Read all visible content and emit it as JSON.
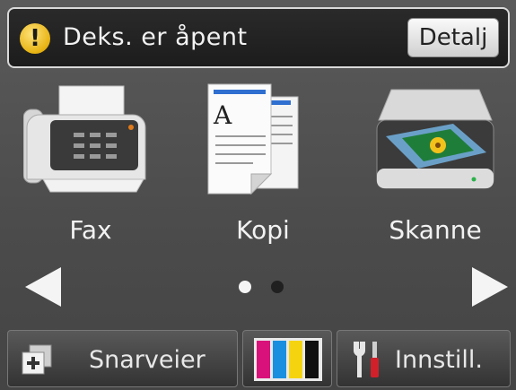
{
  "status": {
    "message": "Deks. er åpent",
    "details_label": "Detalj",
    "icon": "warning-icon"
  },
  "functions": [
    {
      "label": "Fax",
      "icon": "fax-icon"
    },
    {
      "label": "Kopi",
      "icon": "copy-icon"
    },
    {
      "label": "Skanne",
      "icon": "scan-icon"
    }
  ],
  "navigation": {
    "current_page": 1,
    "page_count": 2
  },
  "bottom_bar": {
    "shortcuts_label": "Snarveier",
    "ink_icon": "ink-cartridges-icon",
    "settings_label": "Innstill."
  },
  "ink_colors": {
    "magenta": "#d8127a",
    "cyan": "#1a8fe0",
    "yellow": "#f5d40f",
    "black": "#111111"
  }
}
